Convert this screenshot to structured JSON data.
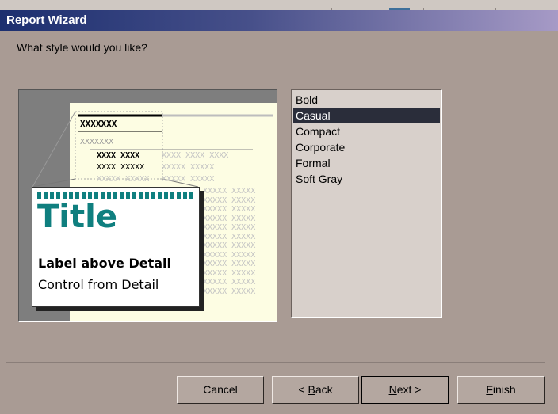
{
  "window": {
    "title": "Report Wizard"
  },
  "prompt": "What style would you like?",
  "preview": {
    "header_text": "XXXXXXX",
    "subheader_text": "XXXXXXX",
    "col_heads": "XXXX  XXXX",
    "col_heads_faded": "XXXX  XXXX  XXXX",
    "row_bold": "XXXX XXXXX",
    "row_text": "XXXXX XXXXX",
    "title_text": "Title",
    "label_text": "Label above Detail",
    "control_text": "Control from Detail"
  },
  "styles": {
    "selected": "Casual",
    "items": [
      "Bold",
      "Casual",
      "Compact",
      "Corporate",
      "Formal",
      "Soft Gray"
    ]
  },
  "buttons": {
    "cancel": "Cancel",
    "back_prefix": "< ",
    "back_access": "B",
    "back_rest": "ack",
    "next_access": "N",
    "next_rest": "ext >",
    "finish_access": "F",
    "finish_rest": "inish"
  },
  "colors": {
    "accent": "#0f7f7f",
    "selection": "#2a2d3a",
    "dialog_bg": "#a99b94"
  }
}
